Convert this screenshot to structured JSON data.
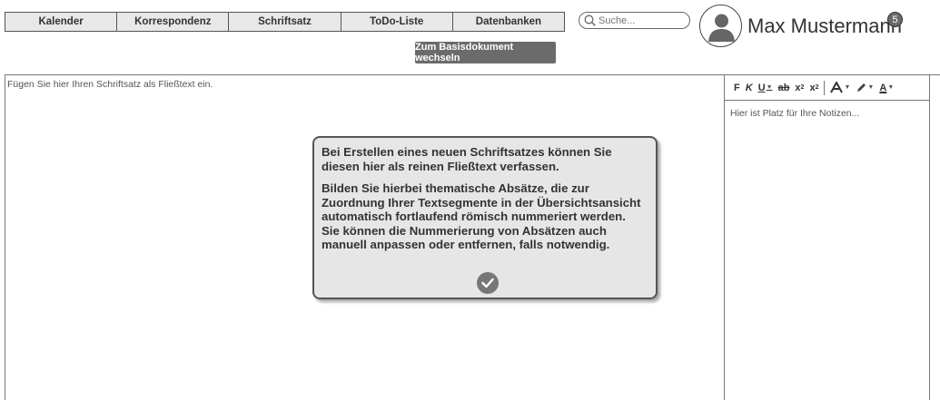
{
  "nav": {
    "items": [
      "Kalender",
      "Korrespondenz",
      "Schriftsatz",
      "ToDo-Liste",
      "Datenbanken"
    ]
  },
  "search": {
    "placeholder": "Suche..."
  },
  "user": {
    "name": "Max Mustermann",
    "notification_count": "5"
  },
  "switch_button": {
    "label": "Zum Basisdokument wechseln"
  },
  "editor": {
    "placeholder": "Fügen Sie hier Ihren Schriftsatz als Fließtext ein."
  },
  "notes": {
    "placeholder": "Hier ist Platz für Ihre Notizen...",
    "toolbar": {
      "bold": "F",
      "italic": "K",
      "underline": "U",
      "strike": "ab",
      "subscript": "x",
      "superscript": "x",
      "font": "A",
      "color_text": "A"
    }
  },
  "dialog": {
    "paragraph1": "Bei Erstellen eines neuen Schriftsatzes können Sie diesen hier als reinen Fließtext verfassen.",
    "paragraph2_line1": "Bilden Sie hierbei thematische Absätze, die  zur Zuordnung Ihrer Textsegmente in der Übersichtsansicht automatisch fortlaufend römisch nummeriert werden.",
    "paragraph2_line2": "Sie können die Nummerierung von Absätzen auch manuell anpassen oder entfernen, falls notwendig."
  },
  "colors": {
    "nav_bg": "#e8e8e8",
    "button_bg": "#6b6b6b",
    "dialog_bg": "#e6e6e6",
    "border": "#555555"
  }
}
